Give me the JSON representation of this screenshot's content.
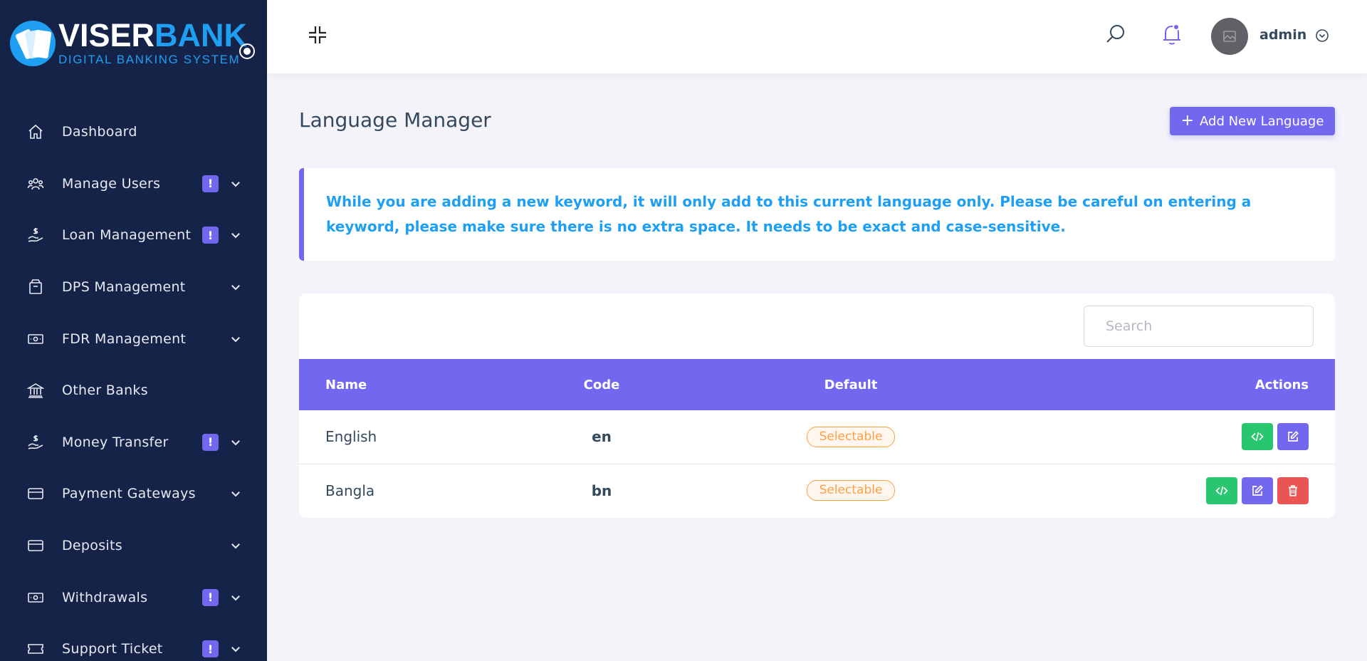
{
  "brand": {
    "name_part1": "VISER",
    "name_part2": "BANK",
    "subtitle": "DIGITAL BANKING SYSTEM"
  },
  "sidebar": {
    "items": [
      {
        "label": "Dashboard",
        "icon": "home-icon",
        "badge": "",
        "has_chevron": false
      },
      {
        "label": "Manage Users",
        "icon": "users-icon",
        "badge": "!",
        "has_chevron": true
      },
      {
        "label": "Loan Management",
        "icon": "hand-dollar-icon",
        "badge": "!",
        "has_chevron": true
      },
      {
        "label": "DPS Management",
        "icon": "box-icon",
        "badge": "",
        "has_chevron": true
      },
      {
        "label": "FDR Management",
        "icon": "money-bill-icon",
        "badge": "",
        "has_chevron": true
      },
      {
        "label": "Other Banks",
        "icon": "bank-icon",
        "badge": "",
        "has_chevron": false
      },
      {
        "label": "Money Transfer",
        "icon": "hand-dollar-icon",
        "badge": "!",
        "has_chevron": true
      },
      {
        "label": "Payment Gateways",
        "icon": "credit-card-icon",
        "badge": "",
        "has_chevron": true
      },
      {
        "label": "Deposits",
        "icon": "credit-card-icon",
        "badge": "",
        "has_chevron": true
      },
      {
        "label": "Withdrawals",
        "icon": "money-bill-icon",
        "badge": "!",
        "has_chevron": true
      },
      {
        "label": "Support Ticket",
        "icon": "ticket-icon",
        "badge": "!",
        "has_chevron": true
      }
    ]
  },
  "topbar": {
    "username": "admin"
  },
  "page": {
    "title": "Language Manager",
    "add_button_label": "Add New Language",
    "alert_text": "While you are adding a new keyword, it will only add to this current language only. Please be careful on entering a keyword, please make sure there is no extra space. It needs to be exact and case-sensitive."
  },
  "table": {
    "search_placeholder": "Search",
    "headers": {
      "name": "Name",
      "code": "Code",
      "default": "Default",
      "actions": "Actions"
    },
    "rows": [
      {
        "name": "English",
        "code": "en",
        "default": "Selectable",
        "actions": [
          "code",
          "edit"
        ]
      },
      {
        "name": "Bangla",
        "code": "bn",
        "default": "Selectable",
        "actions": [
          "code",
          "edit",
          "delete"
        ]
      }
    ]
  },
  "colors": {
    "sidebar_bg": "#162348",
    "primary": "#7367f0",
    "info": "#1e9ff2",
    "success": "#28c76f",
    "danger": "#ea5455",
    "warning": "#ff9f43"
  }
}
